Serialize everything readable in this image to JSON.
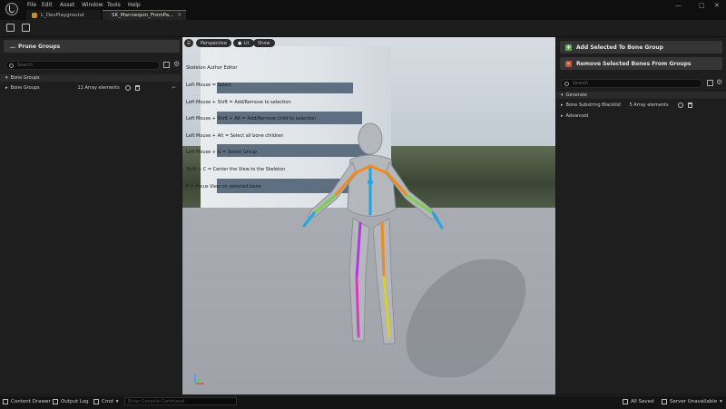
{
  "menu": [
    "File",
    "Edit",
    "Asset",
    "Window",
    "Tools",
    "Help"
  ],
  "tabs": [
    {
      "label": "L_DevPlayground"
    },
    {
      "label": "SK_Mannequin_FromPa..."
    }
  ],
  "left_panel": {
    "prune_button": "Prune Groups",
    "search_placeholder": "Search",
    "section": "Bone Groups",
    "row": {
      "label": "Bone Groups",
      "value": "11 Array elements"
    }
  },
  "viewport": {
    "perspective": "Perspective",
    "lit": "Lit",
    "show": "Show",
    "help_lines": [
      "Skeleton Author Editor",
      "Left Mouse = Select",
      "Left Mouse + Shift = Add/Remove to selection",
      "Left Mouse + Shift + Alt = Add/Remove child to selection",
      "Left Mouse + Alt = Select all bone children",
      "Left Mouse + G = Select Group",
      "Shift + C = Center the View to the Skeleton",
      "F = Focus View on selected bone"
    ]
  },
  "right_panel": {
    "add_button": "Add Selected To Bone Group",
    "remove_button": "Remove Selected Bones From Groups",
    "search_placeholder": "Search",
    "section": "Generate",
    "row": {
      "label": "Bone Substring Blacklist",
      "value": "5 Array elements"
    },
    "advanced": "Advanced"
  },
  "statusbar": {
    "content_drawer": "Content Drawer",
    "output_log": "Output Log",
    "cmd": "Cmd",
    "cmd_placeholder": "Enter Console Command",
    "saved": "All Saved",
    "server": "Server Unavailable"
  },
  "colors": {
    "accent": "#6d4bd8",
    "add": "#4caf3f",
    "remove": "#c8523a"
  }
}
